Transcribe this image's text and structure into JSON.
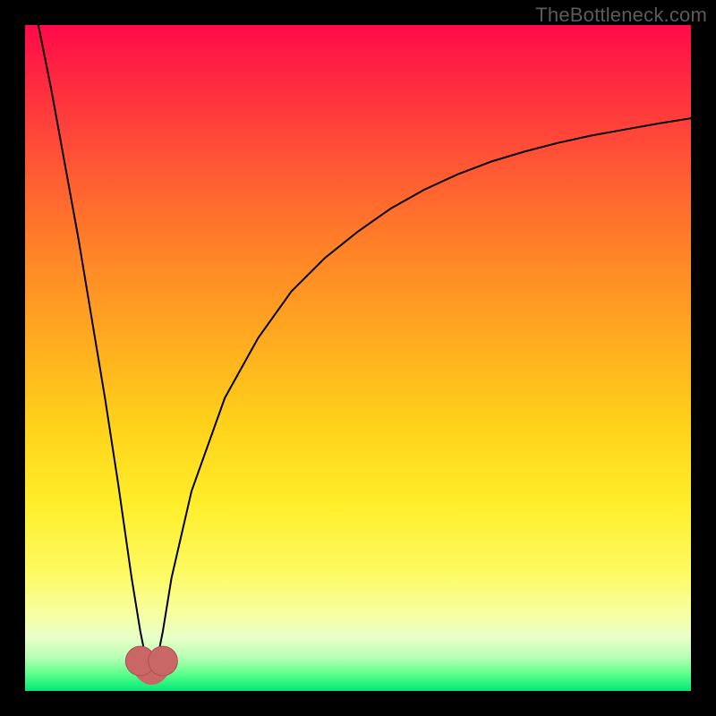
{
  "watermark": "TheBottleneck.com",
  "colors": {
    "frame": "#000000",
    "curve": "#000000",
    "marker_fill": "#c96767",
    "marker_stroke": "#b24d4d"
  },
  "chart_data": {
    "type": "line",
    "title": "",
    "xlabel": "",
    "ylabel": "",
    "xlim": [
      0,
      100
    ],
    "ylim": [
      0,
      100
    ],
    "note": "Axes are unlabeled in the source image; x and y are normalized 0–100. The curve is a V-shaped function with its minimum near x≈19 where y≈2; left branch rises steeply toward the top-left corner, right branch rises with decreasing slope toward the right edge, topping out near y≈86 at x=100.",
    "series": [
      {
        "name": "curve",
        "x": [
          2,
          4,
          6,
          8,
          10,
          12,
          14,
          16,
          17.3,
          18.5,
          19.0,
          19.5,
          20.7,
          22,
          25,
          30,
          35,
          40,
          45,
          50,
          55,
          60,
          65,
          70,
          75,
          80,
          85,
          90,
          95,
          100
        ],
        "y": [
          100,
          90,
          79,
          68,
          56,
          44,
          31,
          17,
          9,
          3,
          2,
          3,
          9,
          17,
          30,
          44,
          53,
          60,
          65,
          69,
          72.5,
          75.3,
          77.6,
          79.5,
          81,
          82.3,
          83.4,
          84.3,
          85.2,
          86
        ]
      }
    ],
    "markers": [
      {
        "x": 17.3,
        "y": 4.5,
        "r": 2.2
      },
      {
        "x": 20.7,
        "y": 4.5,
        "r": 2.2
      }
    ],
    "minimum_bridge": {
      "from_x": 17.3,
      "to_x": 20.7,
      "y": 2.1,
      "stroke_width": 2.6
    }
  }
}
